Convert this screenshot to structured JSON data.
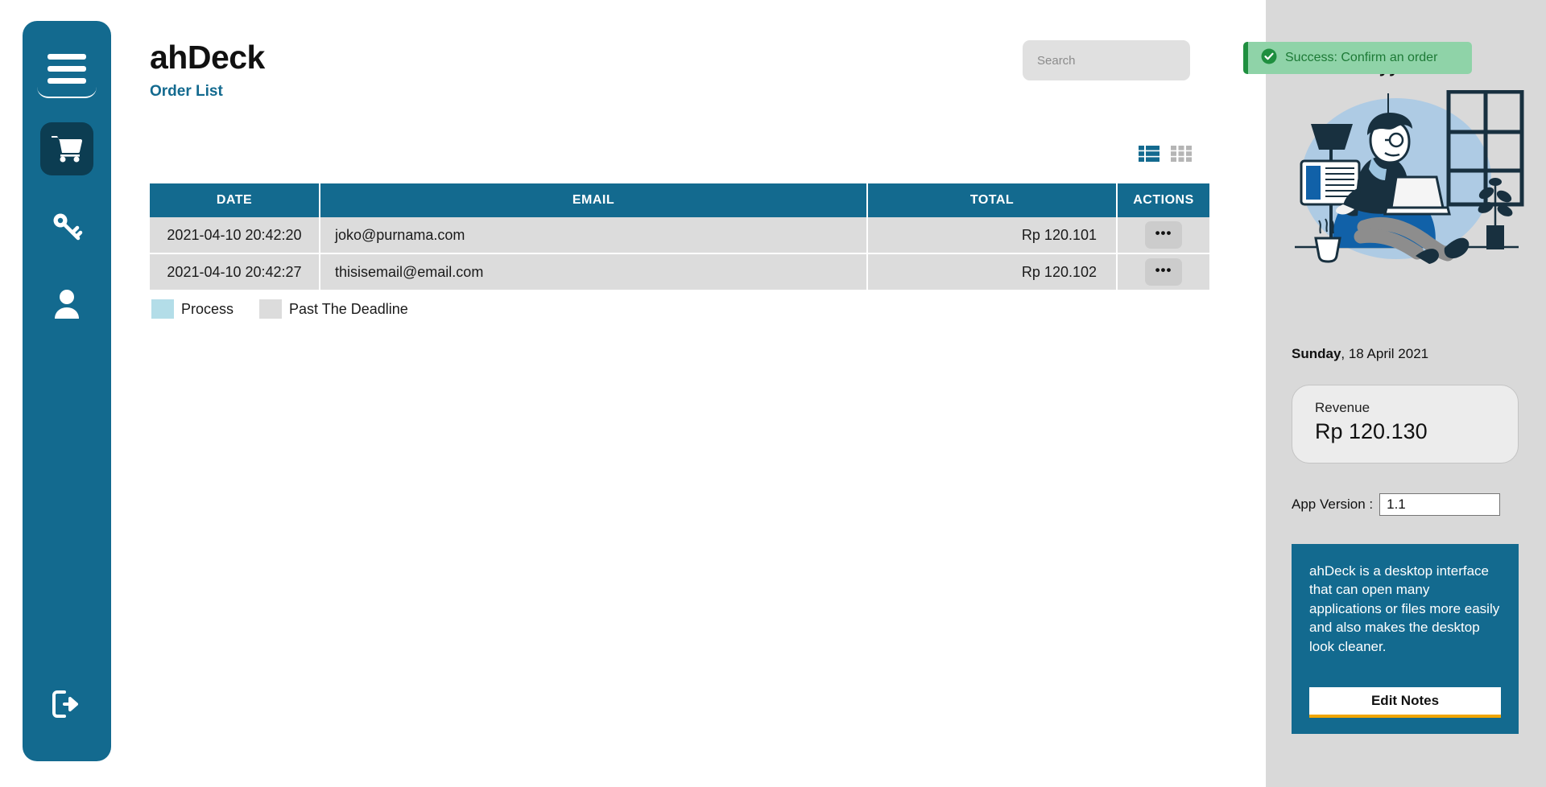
{
  "app": {
    "brand": "ahDeck",
    "page_subtitle": "Order List",
    "accent_color": "#136a8f",
    "sidebar_active_color": "#0c3d52",
    "panel_bg": "#d9d9d9"
  },
  "sidebar": {
    "menu_icon": "hamburger-menu-icon",
    "items": [
      {
        "icon": "cart-icon",
        "label": "Orders",
        "active": true
      },
      {
        "icon": "key-icon",
        "label": "Keys",
        "active": false
      },
      {
        "icon": "user-icon",
        "label": "Account",
        "active": false
      }
    ],
    "logout": {
      "icon": "logout-icon",
      "label": "Logout"
    }
  },
  "search": {
    "placeholder": "Search",
    "value": ""
  },
  "view_toggles": [
    {
      "name": "list-view",
      "active": true
    },
    {
      "name": "grid-view",
      "active": false
    }
  ],
  "table": {
    "columns": [
      "DATE",
      "EMAIL",
      "TOTAL",
      "ACTIONS"
    ],
    "rows": [
      {
        "date": "2021-04-10 20:42:20",
        "email": "joko@purnama.com",
        "total": "Rp 120.101",
        "action": "•••"
      },
      {
        "date": "2021-04-10 20:42:27",
        "email": "thisisemail@email.com",
        "total": "Rp 120.102",
        "action": "•••"
      }
    ]
  },
  "legend": [
    {
      "label": "Process",
      "color": "#b3dde8"
    },
    {
      "label": "Past The Deadline",
      "color": "#dcdcdc"
    }
  ],
  "toast": {
    "icon": "check-circle-icon",
    "message": "Success: Confirm an order",
    "bg": "#8fd3a8",
    "accent": "#1f8f3f"
  },
  "profile": {
    "name": "Ahmad Hayyan",
    "illustration": "person-on-beanbag-with-laptop-illustration"
  },
  "date_display": {
    "weekday": "Sunday",
    "rest": ", 18 April 2021"
  },
  "revenue": {
    "label": "Revenue",
    "value": "Rp 120.130"
  },
  "app_version": {
    "label": "App Version :",
    "value": "1.1"
  },
  "notes": {
    "text": "ahDeck is a desktop interface that can open many applications or files more easily and also makes the desktop look cleaner.",
    "button_label": "Edit Notes",
    "button_accent": "#f0a500"
  }
}
